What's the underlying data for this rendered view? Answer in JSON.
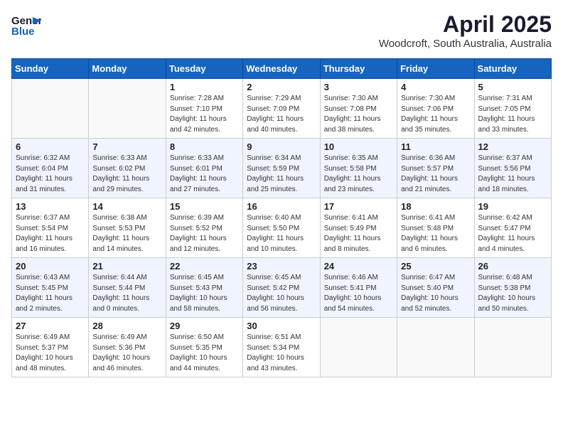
{
  "header": {
    "logo_line1": "General",
    "logo_line2": "Blue",
    "month_year": "April 2025",
    "location": "Woodcroft, South Australia, Australia"
  },
  "days_of_week": [
    "Sunday",
    "Monday",
    "Tuesday",
    "Wednesday",
    "Thursday",
    "Friday",
    "Saturday"
  ],
  "weeks": [
    [
      {
        "num": "",
        "info": ""
      },
      {
        "num": "",
        "info": ""
      },
      {
        "num": "1",
        "info": "Sunrise: 7:28 AM\nSunset: 7:10 PM\nDaylight: 11 hours and 42 minutes."
      },
      {
        "num": "2",
        "info": "Sunrise: 7:29 AM\nSunset: 7:09 PM\nDaylight: 11 hours and 40 minutes."
      },
      {
        "num": "3",
        "info": "Sunrise: 7:30 AM\nSunset: 7:08 PM\nDaylight: 11 hours and 38 minutes."
      },
      {
        "num": "4",
        "info": "Sunrise: 7:30 AM\nSunset: 7:06 PM\nDaylight: 11 hours and 35 minutes."
      },
      {
        "num": "5",
        "info": "Sunrise: 7:31 AM\nSunset: 7:05 PM\nDaylight: 11 hours and 33 minutes."
      }
    ],
    [
      {
        "num": "6",
        "info": "Sunrise: 6:32 AM\nSunset: 6:04 PM\nDaylight: 11 hours and 31 minutes."
      },
      {
        "num": "7",
        "info": "Sunrise: 6:33 AM\nSunset: 6:02 PM\nDaylight: 11 hours and 29 minutes."
      },
      {
        "num": "8",
        "info": "Sunrise: 6:33 AM\nSunset: 6:01 PM\nDaylight: 11 hours and 27 minutes."
      },
      {
        "num": "9",
        "info": "Sunrise: 6:34 AM\nSunset: 5:59 PM\nDaylight: 11 hours and 25 minutes."
      },
      {
        "num": "10",
        "info": "Sunrise: 6:35 AM\nSunset: 5:58 PM\nDaylight: 11 hours and 23 minutes."
      },
      {
        "num": "11",
        "info": "Sunrise: 6:36 AM\nSunset: 5:57 PM\nDaylight: 11 hours and 21 minutes."
      },
      {
        "num": "12",
        "info": "Sunrise: 6:37 AM\nSunset: 5:56 PM\nDaylight: 11 hours and 18 minutes."
      }
    ],
    [
      {
        "num": "13",
        "info": "Sunrise: 6:37 AM\nSunset: 5:54 PM\nDaylight: 11 hours and 16 minutes."
      },
      {
        "num": "14",
        "info": "Sunrise: 6:38 AM\nSunset: 5:53 PM\nDaylight: 11 hours and 14 minutes."
      },
      {
        "num": "15",
        "info": "Sunrise: 6:39 AM\nSunset: 5:52 PM\nDaylight: 11 hours and 12 minutes."
      },
      {
        "num": "16",
        "info": "Sunrise: 6:40 AM\nSunset: 5:50 PM\nDaylight: 11 hours and 10 minutes."
      },
      {
        "num": "17",
        "info": "Sunrise: 6:41 AM\nSunset: 5:49 PM\nDaylight: 11 hours and 8 minutes."
      },
      {
        "num": "18",
        "info": "Sunrise: 6:41 AM\nSunset: 5:48 PM\nDaylight: 11 hours and 6 minutes."
      },
      {
        "num": "19",
        "info": "Sunrise: 6:42 AM\nSunset: 5:47 PM\nDaylight: 11 hours and 4 minutes."
      }
    ],
    [
      {
        "num": "20",
        "info": "Sunrise: 6:43 AM\nSunset: 5:45 PM\nDaylight: 11 hours and 2 minutes."
      },
      {
        "num": "21",
        "info": "Sunrise: 6:44 AM\nSunset: 5:44 PM\nDaylight: 11 hours and 0 minutes."
      },
      {
        "num": "22",
        "info": "Sunrise: 6:45 AM\nSunset: 5:43 PM\nDaylight: 10 hours and 58 minutes."
      },
      {
        "num": "23",
        "info": "Sunrise: 6:45 AM\nSunset: 5:42 PM\nDaylight: 10 hours and 56 minutes."
      },
      {
        "num": "24",
        "info": "Sunrise: 6:46 AM\nSunset: 5:41 PM\nDaylight: 10 hours and 54 minutes."
      },
      {
        "num": "25",
        "info": "Sunrise: 6:47 AM\nSunset: 5:40 PM\nDaylight: 10 hours and 52 minutes."
      },
      {
        "num": "26",
        "info": "Sunrise: 6:48 AM\nSunset: 5:38 PM\nDaylight: 10 hours and 50 minutes."
      }
    ],
    [
      {
        "num": "27",
        "info": "Sunrise: 6:49 AM\nSunset: 5:37 PM\nDaylight: 10 hours and 48 minutes."
      },
      {
        "num": "28",
        "info": "Sunrise: 6:49 AM\nSunset: 5:36 PM\nDaylight: 10 hours and 46 minutes."
      },
      {
        "num": "29",
        "info": "Sunrise: 6:50 AM\nSunset: 5:35 PM\nDaylight: 10 hours and 44 minutes."
      },
      {
        "num": "30",
        "info": "Sunrise: 6:51 AM\nSunset: 5:34 PM\nDaylight: 10 hours and 43 minutes."
      },
      {
        "num": "",
        "info": ""
      },
      {
        "num": "",
        "info": ""
      },
      {
        "num": "",
        "info": ""
      }
    ]
  ]
}
